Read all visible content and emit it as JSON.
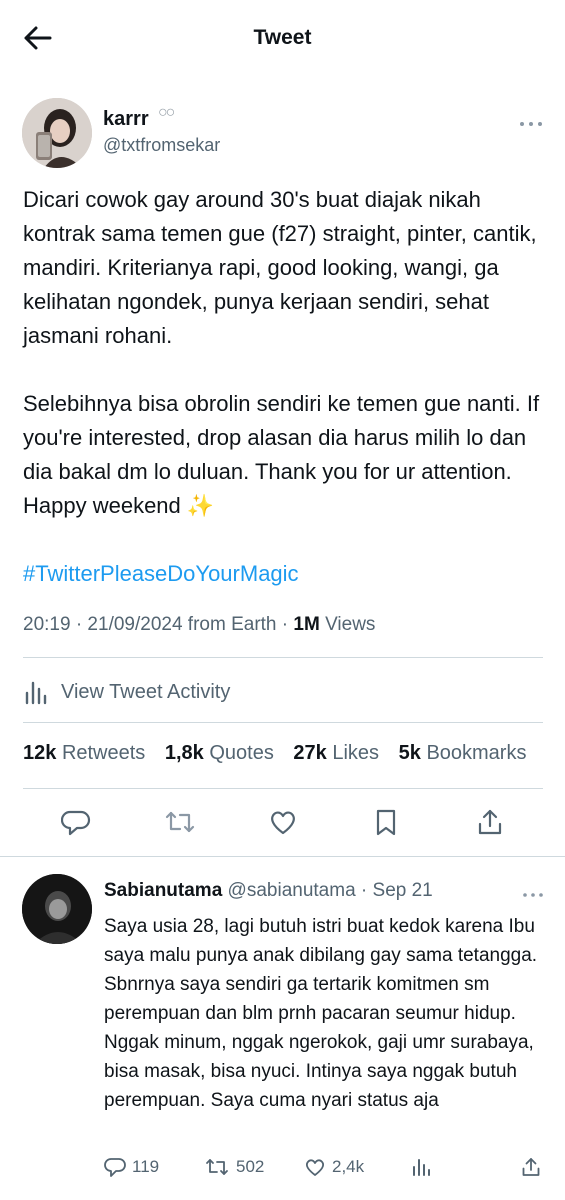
{
  "header": {
    "title": "Tweet"
  },
  "tweet": {
    "author_name": "karrr",
    "author_badge": "○○",
    "author_handle": "@txtfromsekar",
    "paragraphs": [
      "Dicari cowok gay around 30's buat diajak nikah kontrak sama temen gue (f27) straight, pinter, cantik, mandiri. Kriterianya rapi, good looking, wangi, ga kelihatan ngondek, punya kerjaan sendiri, sehat jasmani rohani.",
      "Selebihnya bisa obrolin sendiri ke temen gue nanti. If you're interested, drop alasan dia harus milih lo dan dia bakal dm lo duluan. Thank you for ur attention. Happy weekend ✨"
    ],
    "hashtag": "#TwitterPleaseDoYourMagic",
    "timestamp": "20:19 · 21/09/2024 from Earth · ",
    "views_count": "1M",
    "views_label": " Views",
    "activity_label": "View Tweet Activity",
    "stats": {
      "retweets_count": "12k",
      "retweets_label": "Retweets",
      "quotes_count": "1,8k",
      "quotes_label": "Quotes",
      "likes_count": "27k",
      "likes_label": "Likes",
      "bookmarks_count": "5k",
      "bookmarks_label": "Bookmarks"
    }
  },
  "reply": {
    "name": "Sabianutama",
    "handle": "@sabianutama",
    "date": " · Sep 21",
    "text": "Saya usia 28, lagi butuh istri buat kedok karena Ibu saya malu punya anak dibilang gay sama tetangga. Sbnrnya saya sendiri ga tertarik komitmen sm perempuan dan blm prnh pacaran seumur hidup. Nggak minum, nggak ngerokok, gaji umr surabaya, bisa masak, bisa nyuci. Intinya saya nggak butuh perempuan. Saya cuma nyari status aja",
    "replies": "119",
    "retweets": "502",
    "likes": "2,4k"
  },
  "colors": {
    "accent": "#1d9bf0",
    "text": "#0f1419",
    "muted": "#536471",
    "divider": "#cfd9de"
  }
}
